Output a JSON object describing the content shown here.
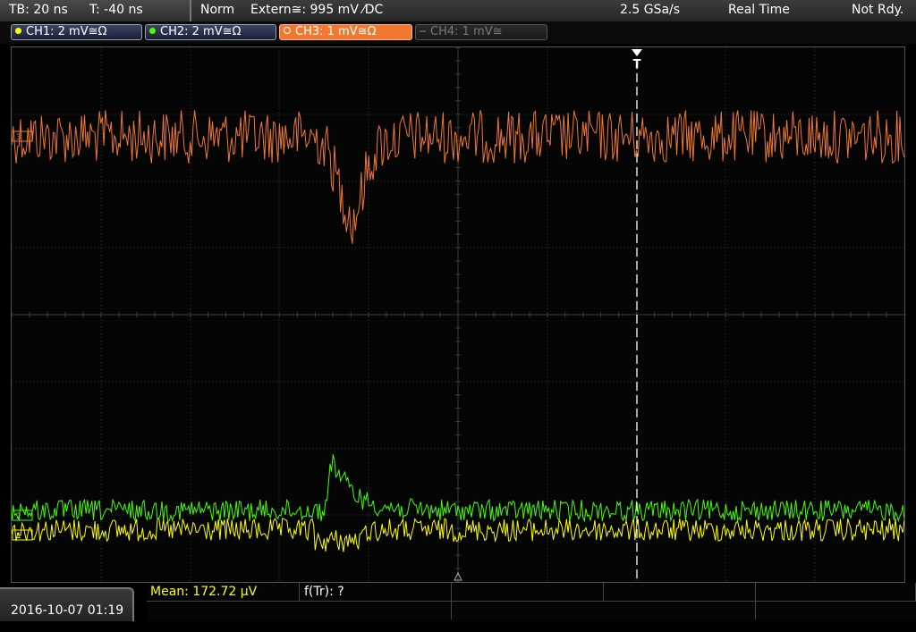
{
  "status_bar": {
    "timebase": "TB: 20 ns",
    "trigger_time": "T: -40 ns",
    "acq_mode": "Norm",
    "trigger_source": "Extern≅: 995 mV ⁄DC",
    "sample_rate": "2.5 GSa/s",
    "mode": "Real Time",
    "ready_state": "Not Rdy."
  },
  "channels": [
    {
      "label": "CH1: 2 mV≅Ω",
      "color": "#ffff00",
      "active": true
    },
    {
      "label": "CH2: 2 mV≅Ω",
      "color": "#44ff00",
      "active": true
    },
    {
      "label": "CH3: 1 mV≅Ω",
      "color": "#f07830",
      "active": true,
      "selected": true
    },
    {
      "label": "CH4: 1 mV≅",
      "color": "#777777",
      "active": false
    }
  ],
  "markers": {
    "trigger": "T",
    "ch3_ref": "3",
    "ch2_ref": "2",
    "ch1_ref": "1"
  },
  "measurement": {
    "mean": "Mean: 172.72 µV",
    "rise_time": "f(Tr): ?"
  },
  "datetime": "2016-10-07 01:19",
  "colors": {
    "ch1": "#ffff00",
    "ch2": "#44ff00",
    "ch3": "#f07830",
    "grid": "#3a3a3a"
  }
}
